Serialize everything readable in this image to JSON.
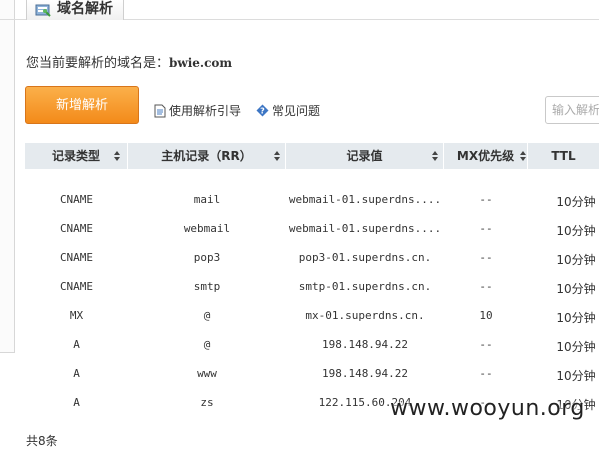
{
  "tab": {
    "title": "域名解析",
    "icon": "dns-settings-icon"
  },
  "domain_info": {
    "label": "您当前要解析的域名是：",
    "domain": "bwie.com"
  },
  "toolbar": {
    "add_button": "新增解析",
    "guide_link": "使用解析引导",
    "faq_link": "常见问题",
    "search_placeholder": "输入解析"
  },
  "table": {
    "headers": [
      "记录类型",
      "主机记录（RR）",
      "记录值",
      "MX优先级",
      "TTL"
    ],
    "rows": [
      [
        "CNAME",
        "mail",
        "webmail-01.superdns....",
        "--",
        "10分钟"
      ],
      [
        "CNAME",
        "webmail",
        "webmail-01.superdns....",
        "--",
        "10分钟"
      ],
      [
        "CNAME",
        "pop3",
        "pop3-01.superdns.cn.",
        "--",
        "10分钟"
      ],
      [
        "CNAME",
        "smtp",
        "smtp-01.superdns.cn.",
        "--",
        "10分钟"
      ],
      [
        "MX",
        "@",
        "mx-01.superdns.cn.",
        "10",
        "10分钟"
      ],
      [
        "A",
        "@",
        "198.148.94.22",
        "--",
        "10分钟"
      ],
      [
        "A",
        "www",
        "198.148.94.22",
        "--",
        "10分钟"
      ],
      [
        "A",
        "zs",
        "122.115.60.204",
        "--",
        "10分钟"
      ]
    ]
  },
  "footer": {
    "text": "共8条"
  },
  "watermark": "www.wooyun.org",
  "colors": {
    "accent": "#f38a1a",
    "header_bg": "#e5eaee"
  }
}
